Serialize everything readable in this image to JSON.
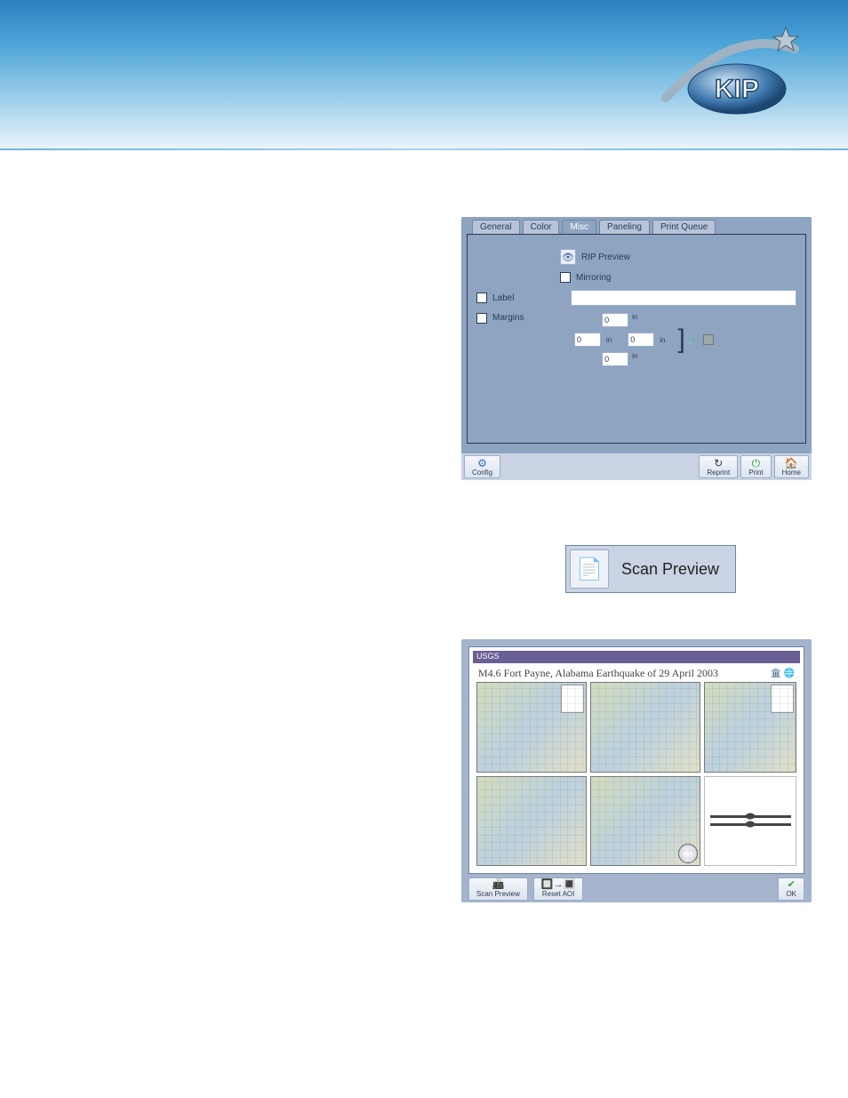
{
  "misc_panel": {
    "tabs": [
      "General",
      "Color",
      "Misc",
      "Paneling",
      "Print Queue"
    ],
    "active_tab": "Misc",
    "rip_preview_label": "RIP Preview",
    "mirroring_label": "Mirroring",
    "label_label": "Label",
    "label_value": "",
    "margins_label": "Margins",
    "margin_top": "0",
    "margin_left": "0",
    "margin_right": "0",
    "margin_bottom": "0",
    "unit": "in",
    "buttons": {
      "config": "Config",
      "reprint": "Reprint",
      "print": "Print",
      "home": "Home"
    }
  },
  "scan_preview_button": "Scan Preview",
  "preview_panel": {
    "usgs": "USGS",
    "title": "M4.6 Fort Payne, Alabama Earthquake of 29 April 2003",
    "buttons": {
      "scan_preview": "Scan Preview",
      "reset_aoi": "Reset AOI",
      "ok": "OK"
    }
  }
}
